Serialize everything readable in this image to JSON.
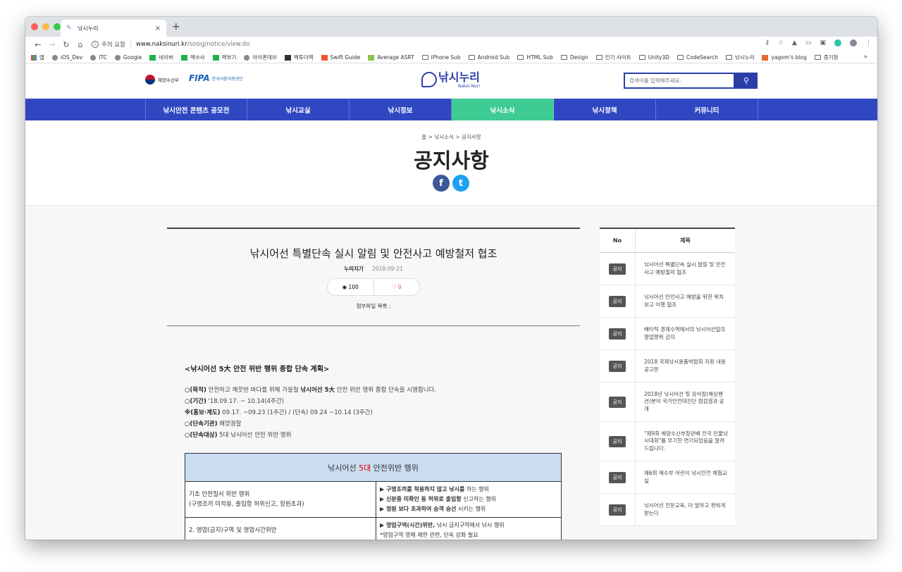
{
  "browser": {
    "tab_title": "낚시누리",
    "new_tab": "+",
    "url_warning": "주의 요함",
    "url_host": "www.naksinuri.kr",
    "url_path": "/sosig/notice/view.do",
    "bookmarks": [
      "앱",
      "iOS_Dev",
      "ITC",
      "Google",
      "네이버",
      "맥쓰사",
      "맥부기",
      "아이폰데브",
      "벡투더맥",
      "Swift Guide",
      "Average ASRT",
      "iPhone Sub",
      "Android Sub",
      "HTML Sub",
      "Design",
      "인기 사이트",
      "Unity3D",
      "CodeSearch",
      "낚시누리",
      "yagom's blog",
      "증기청"
    ],
    "bookmarks_more": "»"
  },
  "header": {
    "gov_logo_text": "해양수산부",
    "fipa_mark": "FIPA",
    "fipa_text": "한국어촌어항공단",
    "logo_name": "낚시누리",
    "logo_sub": "Naksi-Nuri",
    "search_placeholder": "검색어를 입력해주세요.",
    "search_icon": "search-icon"
  },
  "gnb": {
    "items": [
      "낚시안전 콘텐츠 공모전",
      "낚시교실",
      "낚시정보",
      "낚시소식",
      "낚시정책",
      "커뮤니티"
    ],
    "active_index": 3
  },
  "title_area": {
    "breadcrumb": "홈 > 낚시소식 > 공지사항",
    "title": "공지사항",
    "facebook": "f",
    "twitter": "t"
  },
  "article": {
    "title": "낚시어선 특별단속 실시 알림 및 안전사고 예방철저 협조",
    "author": "누리지기",
    "date": "2018-09-21",
    "views": "100",
    "likes": "0",
    "attachments_label": "첨부파일 목록 :",
    "heading": "<낚시어선 5大 안전 위반 행위 종합 단속 계획>",
    "lines": [
      {
        "label": "○(목적)",
        "text1": " 안전하고 깨끗한 바다를 위해 가을철 ",
        "bold2": "낚시어선 5大",
        "text2": " 안전 위반 행위 종합 단속을 시행합니다."
      },
      {
        "label": "○(기간)",
        "text1": " '18.09.17. ~ 10.14(4주간)",
        "bold2": "",
        "text2": ""
      },
      {
        "label": "※(홍보·계도)",
        "text1": " 09.17. ~09.23 (1주간) / (단속) 09.24 ~10.14 (3주간)",
        "bold2": "",
        "text2": ""
      },
      {
        "label": "○(단속기관)",
        "text1": " 해양경찰",
        "bold2": "",
        "text2": ""
      },
      {
        "label": "○(단속대상)",
        "text1": " 5대 낚시어선 안전 위반 행위",
        "bold2": "",
        "text2": ""
      }
    ],
    "table": {
      "header_pre": "낚시어선 ",
      "header_red": "5대",
      "header_post": " 안전위반 행위",
      "rows": [
        {
          "left": [
            "기초 안전질서 위반 행위",
            "(구명조끼 미착용, 출입항 허위신고, 정원초과)"
          ],
          "right": [
            {
              "b": "▶ 구명조끼를 착용하지 않고 낚시를",
              "t": " 하는 행위"
            },
            {
              "b": "▶ 신분증 미확인 등 허위로 출입항",
              "t": " 신고하는 행위"
            },
            {
              "b": "▶ 정원 보다 초과하여 승객 승선",
              "t": " 시키는 행위"
            }
          ]
        },
        {
          "left": [
            "2. 영업(금지)구역 및 영업시간위반"
          ],
          "right": [
            {
              "b": "▶ 영업구역(시간)위반,",
              "t": " 낚시 금지구역에서 낚시 행위"
            },
            {
              "b": "",
              "t": "*영업구역 영해 제한 관련, 단속 강화 필요"
            }
          ]
        }
      ]
    }
  },
  "sidebar": {
    "col_no": "No",
    "col_title": "제목",
    "badge": "공지",
    "items": [
      "낚시어선 특별단속 실시 알림 및 안전사고 예방철저 협조",
      "낚시어선 안전사고 예방을 위한 위치보고 이행 협조",
      "배타적 경제수역에서의 낚시어선업의 영업행위 금지",
      "2018 국제낚시용품박람회 지원 내용 공고문",
      "2018년 낚시어선 및 유어장(해상펜션)분야 국가안전대진단 점검결과 공개",
      "\"제9회 해양수산부장관배 전국 민물낚시대회\"를 무기한 연기되었음을 알려드립니다.",
      "제6회 해수부 어린이 낚시안전 체험교실",
      "낚시어선 전문교육, 더 알차고 편하게 받는다"
    ]
  }
}
